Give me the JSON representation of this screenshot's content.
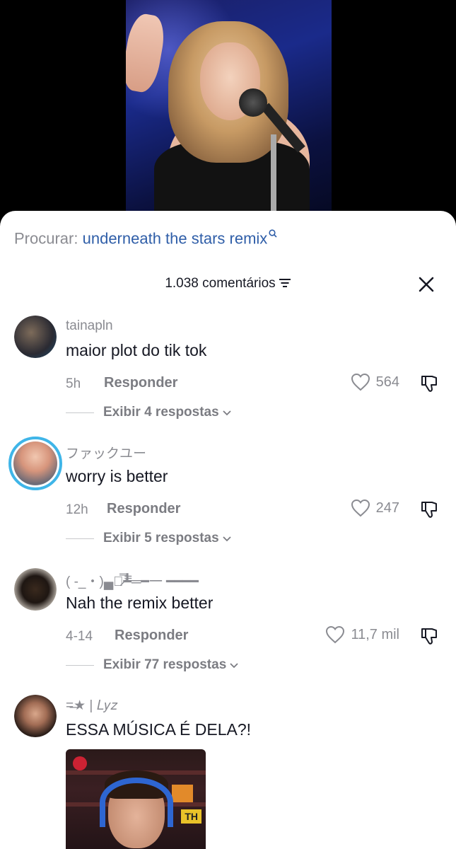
{
  "search": {
    "prefix": "Procurar:",
    "query": "underneath the stars remix"
  },
  "header": {
    "count_label": "1.038 comentários"
  },
  "comments": [
    {
      "username": "tainapln",
      "text": "maior plot do tik tok",
      "time": "5h",
      "reply_label": "Responder",
      "likes": "564",
      "replies_label": "Exibir 4 respostas"
    },
    {
      "username": "ファックユー",
      "text": "worry is better",
      "time": "12h",
      "reply_label": "Responder",
      "likes": "247",
      "replies_label": "Exibir 5 respostas"
    },
    {
      "username": "( -_・)▄︻̷̿┻̿═━一 ━━━━",
      "text": "Nah the remix better",
      "time": "4-14",
      "reply_label": "Responder",
      "likes": "11,7 mil",
      "replies_label": "Exibir 77 respostas"
    },
    {
      "username": "=̶★ | 𝐿𝑦𝑧",
      "text": "ESSA MÚSICA É DELA?!"
    }
  ],
  "attached_image_tag": "TH",
  "colors": {
    "query_link": "#2f5ea8",
    "story_ring": "#3fb5e8",
    "muted_text": "#8a8b91",
    "primary_text": "#161823"
  }
}
